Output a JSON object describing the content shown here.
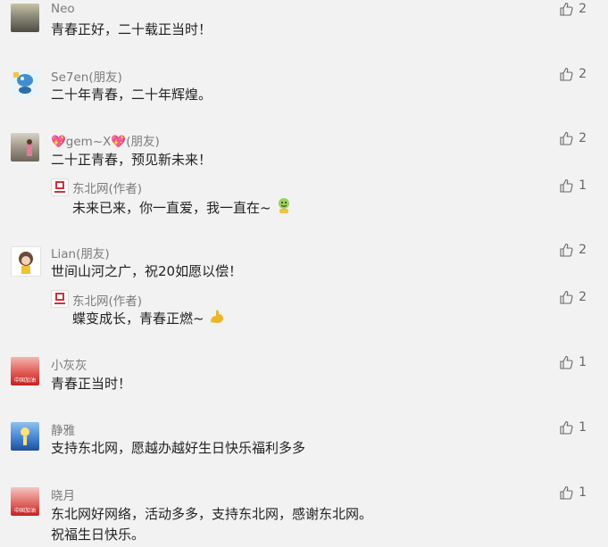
{
  "comments": [
    {
      "name": "Neo",
      "text": "青春正好，二十载正当时！",
      "likes": "2"
    },
    {
      "name": "Se7en(朋友)",
      "text": "二十年青春，二十年辉煌。",
      "likes": "2"
    },
    {
      "name": "💖gem~X💖(朋友)",
      "text": "二十正青春，预见新未来！",
      "likes": "2",
      "reply": {
        "name": "东北网(作者)",
        "text": "未来已来，你一直爱，我一直在~",
        "likes": "1"
      }
    },
    {
      "name": "Lian(朋友)",
      "text": "世间山河之广，祝20如愿以偿！",
      "likes": "2",
      "reply": {
        "name": "东北网(作者)",
        "text": "蝶变成长，青春正燃~",
        "likes": "2"
      }
    },
    {
      "name": "小灰灰",
      "text": "青春正当时！",
      "likes": "1"
    },
    {
      "name": "静雅",
      "text": "支持东北网，愿越办越好生日快乐福利多多",
      "likes": "1"
    },
    {
      "name": "晓月",
      "text": "东北网好网络，活动多多，支持东北网，感谢东北网。",
      "text2": "祝福生日快乐。",
      "likes": "1"
    }
  ],
  "avatar_captions": {
    "c5": "中国加油",
    "c7": "中国加油"
  }
}
